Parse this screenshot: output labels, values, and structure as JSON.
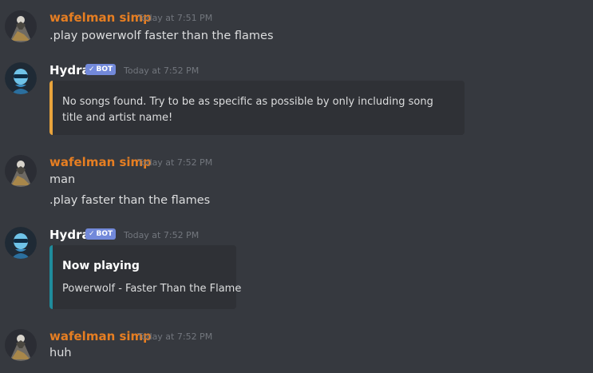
{
  "colors": {
    "background": "#36393f",
    "user_name": "#e67e22",
    "bot_name": "#ffffff",
    "bot_tag": "#7289da",
    "embed_bg": "#2f3136",
    "embed_bar_warning": "#e8a33c",
    "embed_bar_playing": "#1f8b9c",
    "timestamp": "#72767d"
  },
  "messages": [
    {
      "author": "wafelman simp",
      "timestamp": "Today at 7:51 PM",
      "lines": [
        ".play powerwolf faster than the flames"
      ]
    },
    {
      "author": "Hydra",
      "bot_tag": "BOT",
      "timestamp": "Today at 7:52 PM",
      "embed": {
        "description": "No songs found. Try to be as specific as possible by only including song title and artist name!"
      }
    },
    {
      "author": "wafelman simp",
      "timestamp": "Today at 7:52 PM",
      "lines": [
        "man",
        ".play faster than the flames"
      ]
    },
    {
      "author": "Hydra",
      "bot_tag": "BOT",
      "timestamp": "Today at 7:52 PM",
      "embed": {
        "title": "Now playing",
        "description": "Powerwolf - Faster Than the Flame"
      }
    },
    {
      "author": "wafelman simp",
      "timestamp": "Today at 7:52 PM",
      "lines": [
        "huh"
      ]
    }
  ],
  "icons": {
    "verified": "checkmark-icon"
  }
}
